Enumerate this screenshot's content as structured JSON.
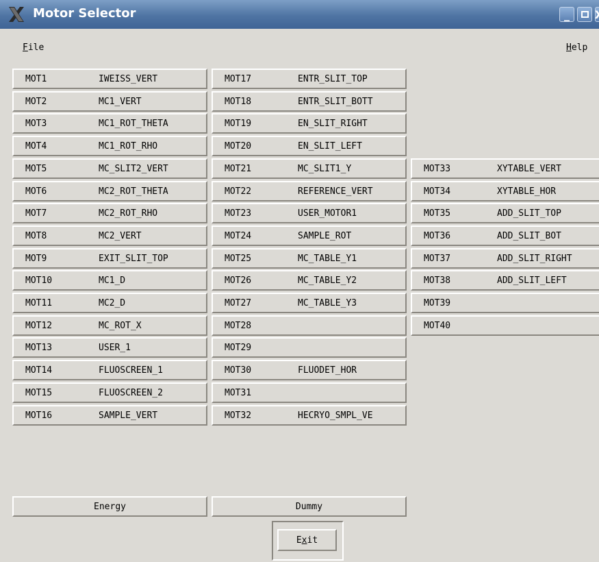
{
  "window": {
    "title": "Motor Selector"
  },
  "menubar": {
    "file": "File",
    "help": "Help"
  },
  "motors": [
    {
      "id": "MOT1",
      "name": "IWEISS_VERT"
    },
    {
      "id": "MOT2",
      "name": "MC1_VERT"
    },
    {
      "id": "MOT3",
      "name": "MC1_ROT_THETA"
    },
    {
      "id": "MOT4",
      "name": "MC1_ROT_RHO"
    },
    {
      "id": "MOT5",
      "name": "MC_SLIT2_VERT"
    },
    {
      "id": "MOT6",
      "name": "MC2_ROT_THETA"
    },
    {
      "id": "MOT7",
      "name": "MC2_ROT_RHO"
    },
    {
      "id": "MOT8",
      "name": "MC2_VERT"
    },
    {
      "id": "MOT9",
      "name": "EXIT_SLIT_TOP"
    },
    {
      "id": "MOT10",
      "name": "MC1_D"
    },
    {
      "id": "MOT11",
      "name": "MC2_D"
    },
    {
      "id": "MOT12",
      "name": "MC_ROT_X"
    },
    {
      "id": "MOT13",
      "name": "USER_1"
    },
    {
      "id": "MOT14",
      "name": "FLUOSCREEN_1"
    },
    {
      "id": "MOT15",
      "name": "FLUOSCREEN_2"
    },
    {
      "id": "MOT16",
      "name": "SAMPLE_VERT"
    },
    {
      "id": "MOT17",
      "name": "ENTR_SLIT_TOP"
    },
    {
      "id": "MOT18",
      "name": "ENTR_SLIT_BOTT"
    },
    {
      "id": "MOT19",
      "name": "EN_SLIT_RIGHT"
    },
    {
      "id": "MOT20",
      "name": "EN_SLIT_LEFT"
    },
    {
      "id": "MOT21",
      "name": "MC_SLIT1_Y"
    },
    {
      "id": "MOT22",
      "name": "REFERENCE_VERT"
    },
    {
      "id": "MOT23",
      "name": "USER_MOTOR1"
    },
    {
      "id": "MOT24",
      "name": "SAMPLE_ROT"
    },
    {
      "id": "MOT25",
      "name": "MC_TABLE_Y1"
    },
    {
      "id": "MOT26",
      "name": "MC_TABLE_Y2"
    },
    {
      "id": "MOT27",
      "name": "MC_TABLE_Y3"
    },
    {
      "id": "MOT28",
      "name": ""
    },
    {
      "id": "MOT29",
      "name": ""
    },
    {
      "id": "MOT30",
      "name": "FLUODET_HOR"
    },
    {
      "id": "MOT31",
      "name": ""
    },
    {
      "id": "MOT32",
      "name": "HECRYO_SMPL_VE"
    },
    {
      "id": "MOT33",
      "name": "XYTABLE_VERT"
    },
    {
      "id": "MOT34",
      "name": "XYTABLE_HOR"
    },
    {
      "id": "MOT35",
      "name": "ADD_SLIT_TOP"
    },
    {
      "id": "MOT36",
      "name": "ADD_SLIT_BOT"
    },
    {
      "id": "MOT37",
      "name": "ADD_SLIT_RIGHT"
    },
    {
      "id": "MOT38",
      "name": "ADD_SLIT_LEFT"
    },
    {
      "id": "MOT39",
      "name": ""
    },
    {
      "id": "MOT40",
      "name": ""
    }
  ],
  "extra_buttons": {
    "energy": "Energy",
    "dummy": "Dummy"
  },
  "exit": {
    "label": "Exit"
  }
}
